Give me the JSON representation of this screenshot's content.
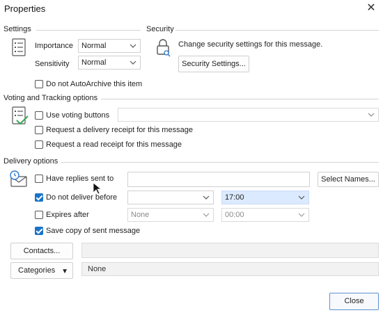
{
  "window": {
    "title": "Properties"
  },
  "settings": {
    "group_label": "Settings",
    "importance_label": "Importance",
    "importance_value": "Normal",
    "sensitivity_label": "Sensitivity",
    "sensitivity_value": "Normal",
    "no_autoarchive_label": "Do not AutoArchive this item"
  },
  "security": {
    "group_label": "Security",
    "description": "Change security settings for this message.",
    "button_label": "Security Settings..."
  },
  "voting": {
    "group_label": "Voting and Tracking options",
    "use_voting_label": "Use voting buttons",
    "use_voting_value": "",
    "delivery_receipt_label": "Request a delivery receipt for this message",
    "read_receipt_label": "Request a read receipt for this message"
  },
  "delivery": {
    "group_label": "Delivery options",
    "have_replies_label": "Have replies sent to",
    "have_replies_value": "",
    "select_names_label": "Select Names...",
    "do_not_deliver_label": "Do not deliver before",
    "do_not_deliver_date": "",
    "do_not_deliver_time": "17:00",
    "expires_label": "Expires after",
    "expires_date": "None",
    "expires_time": "00:00",
    "save_copy_label": "Save copy of sent message"
  },
  "footer": {
    "contacts_label": "Contacts...",
    "contacts_value": "",
    "categories_label": "Categories",
    "categories_value": "None",
    "close_label": "Close"
  }
}
